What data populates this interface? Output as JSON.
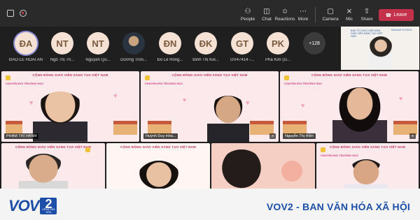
{
  "toolbar": {
    "timer": "",
    "buttons": [
      {
        "label": "People",
        "icon": "people-icon"
      },
      {
        "label": "Chat",
        "icon": "chat-icon"
      },
      {
        "label": "Reactions",
        "icon": "reactions-icon"
      },
      {
        "label": "More",
        "icon": "more-icon"
      },
      {
        "label": "Camera",
        "icon": "camera-icon"
      },
      {
        "label": "Mic",
        "icon": "mic-icon"
      },
      {
        "label": "Share",
        "icon": "share-icon"
      }
    ],
    "leave_label": "Leave"
  },
  "participants": [
    {
      "initials": "ĐA",
      "name": "ĐÀO LÊ HOÀI AN",
      "ring": true
    },
    {
      "initials": "NT",
      "name": "Ngô Thị Th..."
    },
    {
      "initials": "NT",
      "name": "Nguyễn Qu..."
    },
    {
      "initials": "",
      "name": "Dương Tron...",
      "photo": true
    },
    {
      "initials": "ĐN",
      "name": "Đỗ Lê Hồng..."
    },
    {
      "initials": "ĐK",
      "name": "Đinh Thị Kiề..."
    },
    {
      "initials": "GT",
      "name": "GV47414 -..."
    },
    {
      "initials": "PK",
      "name": "Pha Kim (G..."
    },
    {
      "initials": "+128",
      "name": ""
    }
  ],
  "featured": {
    "banner": "BAN TỔ CHỨC DIỄN ĐÀN GIÁO VIÊN SÁNG TẠO VIỆT NAM",
    "logo": "Microsoft SCHOOL"
  },
  "tiles": [
    {
      "banner": "CỘNG ĐỒNG GIÁO VIÊN SÁNG TẠO VIỆT NAM",
      "brand": "CHUYỂN ĐỔI TRƯỜNG HỌC",
      "name": "PHẠM THỊ HẠNH"
    },
    {
      "banner": "CỘNG ĐỒNG GIÁO VIÊN SÁNG TẠO VIỆT NAM",
      "brand": "CHUYỂN ĐỔI TRƯỜNG HỌC",
      "name": "Huỳnh Duy Hòa..."
    },
    {
      "banner": "CỘNG ĐỒNG GIÁO VIÊN SÁNG TẠO VIỆT NAM",
      "brand": "CHUYỂN ĐỔI TRƯỜNG HỌC",
      "name": "Nguyễn Thị Hiền"
    },
    {
      "banner": "CỘNG ĐỒNG GIÁO VIÊN SÁNG TẠO VIỆT NAM",
      "brand": "CHUYỂN ĐỔI TRƯỜNG HỌC",
      "name": ""
    },
    {
      "banner": "CỘNG ĐỒNG GIÁO VIÊN SÁNG TẠO VIỆT NAM",
      "brand": "",
      "name": ""
    },
    {
      "banner": "CỘNG ĐỒNG GIÁO VIÊN SÁNG TẠO VIỆT NAM",
      "brand": "CHUYỂN ĐỔI TRƯỜNG HỌC",
      "name": ""
    }
  ],
  "footer": {
    "logo_text": "VOV",
    "logo_number": "2",
    "logo_sub": "KÊNH VĂN HÓA",
    "caption": "VOV2 - BAN VĂN HÓA XÃ HỘI"
  },
  "colors": {
    "leave": "#c4314b",
    "brand_blue": "#1d4fa8",
    "banner_pink": "#c0325e"
  }
}
